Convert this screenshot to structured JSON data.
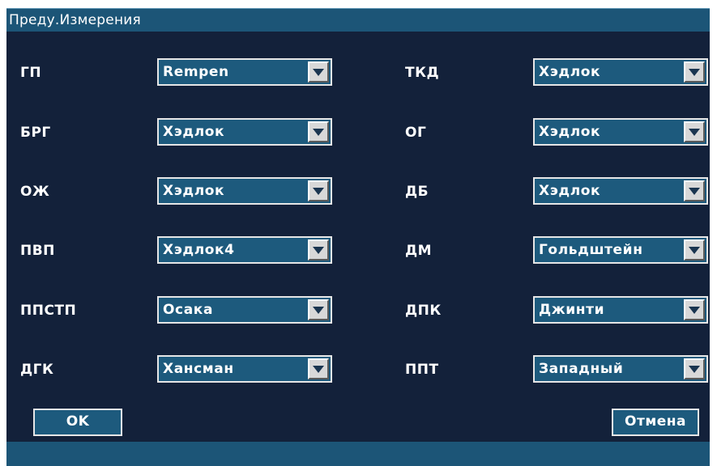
{
  "dialog": {
    "title": "Преду.Измерения"
  },
  "left_fields": [
    {
      "label": "ГП",
      "value": "Rempen"
    },
    {
      "label": "БРГ",
      "value": "Хэдлок"
    },
    {
      "label": "ОЖ",
      "value": "Хэдлок"
    },
    {
      "label": "ПВП",
      "value": "Хэдлок4"
    },
    {
      "label": "ППСТП",
      "value": "Осака"
    },
    {
      "label": "ДГК",
      "value": "Хансман"
    }
  ],
  "right_fields": [
    {
      "label": "ТКД",
      "value": "Хэдлок"
    },
    {
      "label": "ОГ",
      "value": "Хэдлок"
    },
    {
      "label": "ДБ",
      "value": "Хэдлок"
    },
    {
      "label": "ДМ",
      "value": "Гольдштейн"
    },
    {
      "label": "ДПК",
      "value": "Джинти"
    },
    {
      "label": "ППТ",
      "value": "Западный"
    }
  ],
  "buttons": {
    "ok": "OK",
    "cancel": "Отмена"
  },
  "colors": {
    "background": "#13213a",
    "accent": "#1c5577",
    "field": "#1d5a7d"
  },
  "icons": {
    "dropdown": "chevron-down-icon"
  }
}
